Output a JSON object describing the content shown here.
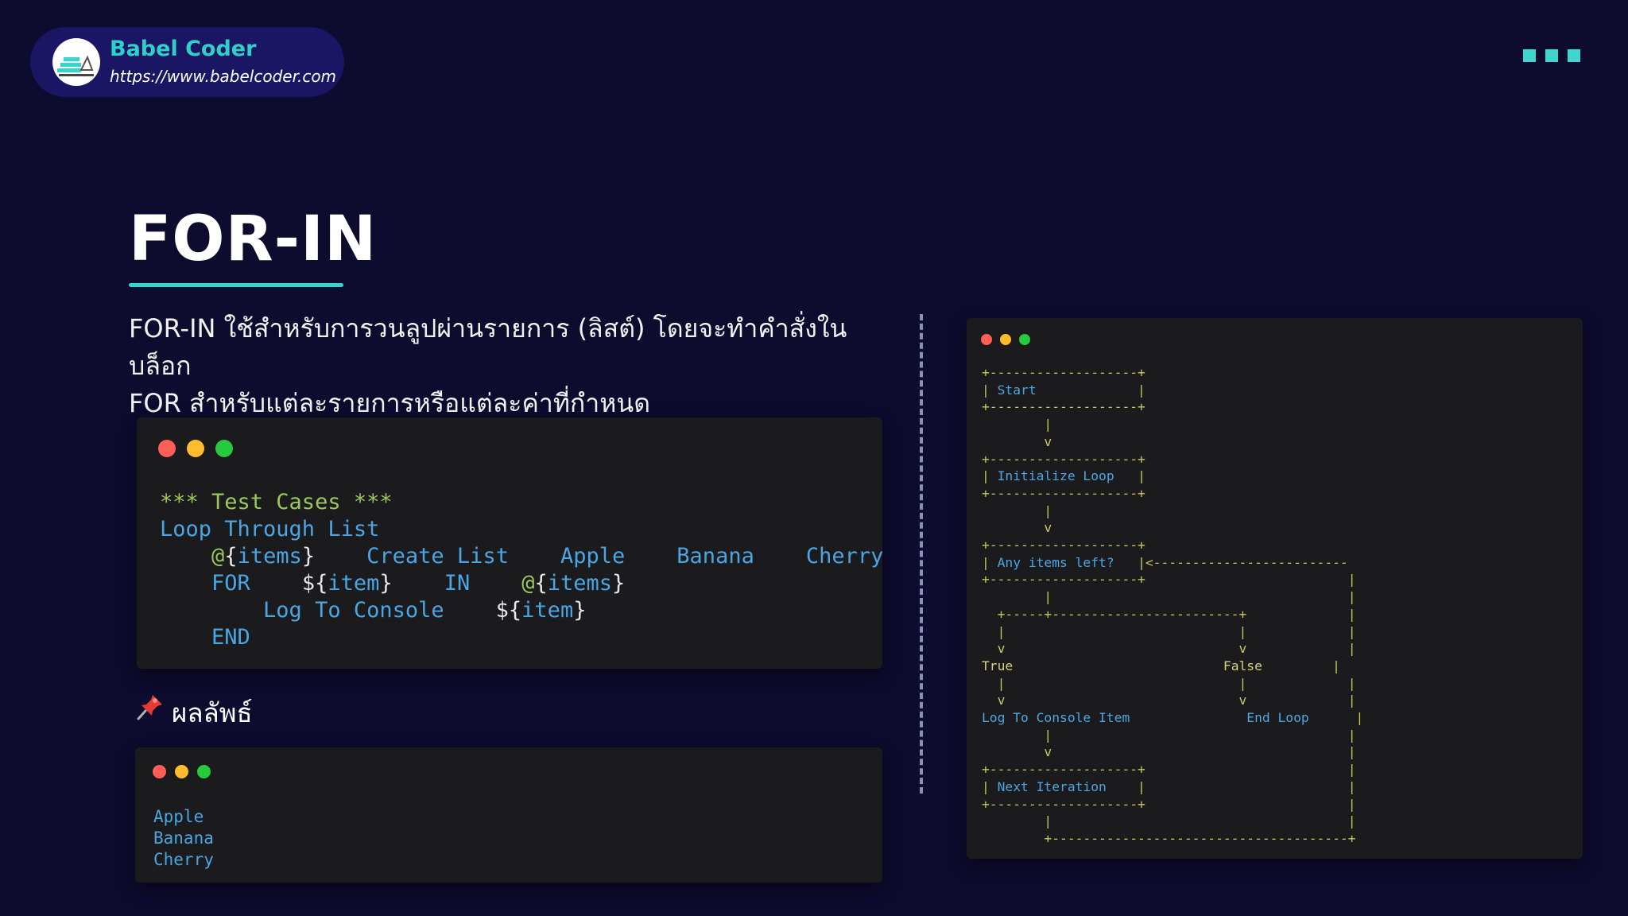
{
  "brand": {
    "name": "Babel Coder",
    "url": "https://www.babelcoder.com"
  },
  "slide": {
    "title": "FOR-IN",
    "description_line1": "FOR-IN ใช้สำหรับการวนลูปผ่านรายการ (ลิสต์) โดยจะทำคำสั่งในบล็อก",
    "description_line2": "FOR สำหรับแต่ละรายการหรือแต่ละค่าที่กำหนด"
  },
  "code": {
    "header": "*** Test Cases ***",
    "test_name": "Loop Through List",
    "l3_var": "@{items}",
    "l3_kw": "Create List",
    "l3_a": "Apple",
    "l3_b": "Banana",
    "l3_c": "Cherry",
    "l4_for": "FOR",
    "l4_var": "${item}",
    "l4_in": "IN",
    "l4_list": "@{items}",
    "l5_kw": "Log To Console",
    "l5_var": "${item}",
    "l6_end": "END"
  },
  "result": {
    "label": "ผลลัพธ์",
    "lines": [
      "Apple",
      "Banana",
      "Cherry"
    ]
  },
  "flow": {
    "start": "Start",
    "init": "Initialize Loop",
    "check": "Any items left?",
    "true_label": "True",
    "false_label": "False",
    "log": "Log To Console Item",
    "end": "End Loop",
    "next": "Next Iteration"
  },
  "colors": {
    "background": "#0d0b2e",
    "accent": "#35d4cf",
    "code_blue": "#4aa6e3",
    "code_green": "#9ac85a",
    "traffic_red": "#ff5f56",
    "traffic_yellow": "#ffbd2e",
    "traffic_green": "#27c93f"
  },
  "icons": [
    "babel-coder-logo",
    "pushpin-icon",
    "window-dots-icon"
  ]
}
